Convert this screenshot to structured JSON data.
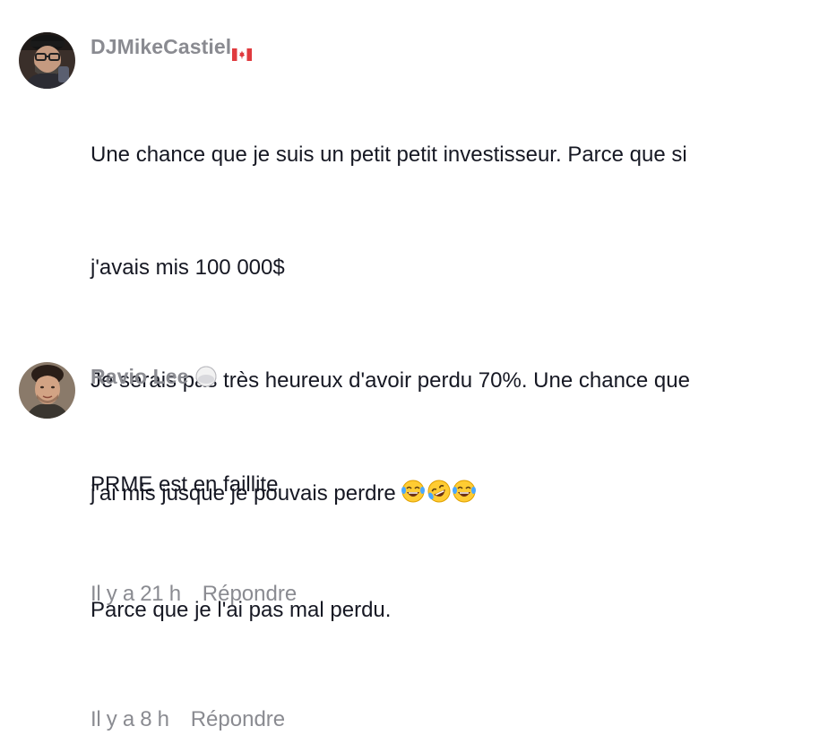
{
  "comments": [
    {
      "username": "DJMikeCastiel",
      "flag_icon": "canada-flag-icon",
      "lines": [
        "Une chance que je suis un petit petit investisseur. Parce que si",
        "j'avais mis 100 000$",
        "Je serais pas très heureux d'avoir perdu 70%. Une chance que",
        "j'ai mis jusque je pouvais perdre",
        "Parce que je l'ai pas mal perdu."
      ],
      "emojis": [
        "laughing-tears-emoji",
        "rolling-laughing-emoji",
        "laughing-tears-emoji"
      ],
      "time": "Il y a 8 h",
      "reply_label": "Répondre"
    },
    {
      "username": "Ravio Lee",
      "badge_icon": "white-circle-badge-icon",
      "lines": [
        "PRME est en faillite"
      ],
      "time": "Il y a 21 h",
      "reply_label": "Répondre"
    }
  ],
  "colors": {
    "username": "#8a8b91",
    "text": "#161823",
    "meta": "#8a8b91",
    "background": "#ffffff"
  }
}
